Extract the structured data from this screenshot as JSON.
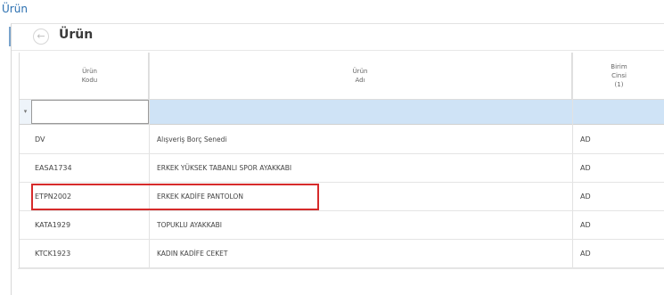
{
  "window": {
    "title": "Ürün"
  },
  "toolbar": {
    "back_icon": "back-arrow-icon",
    "title": "Ürün"
  },
  "grid": {
    "columns": [
      {
        "lines": [
          "Ürün",
          "Kodu"
        ]
      },
      {
        "lines": [
          "Ürün",
          "Adı"
        ]
      },
      {
        "lines": [
          "Birim",
          "Cinsi",
          "(1)"
        ]
      }
    ],
    "filter": {
      "marker": "▾",
      "value": ""
    },
    "rows": [
      {
        "code": "DV",
        "name": "Alışveriş Borç Senedi",
        "unit": "AD"
      },
      {
        "code": "EASA1734",
        "name": "ERKEK YÜKSEK TABANLI SPOR AYAKKABI",
        "unit": "AD"
      },
      {
        "code": "ETPN2002",
        "name": "ERKEK KADİFE PANTOLON",
        "unit": "AD",
        "highlighted": true
      },
      {
        "code": "KATA1929",
        "name": "TOPUKLU AYAKKABI",
        "unit": "AD"
      },
      {
        "code": "KTCK1923",
        "name": "KADIN KADİFE CEKET",
        "unit": "AD"
      }
    ]
  },
  "colors": {
    "highlight_border": "#d62b2b",
    "filter_row_bg": "#cfe3f6",
    "title_blue": "#2a6fb0"
  }
}
